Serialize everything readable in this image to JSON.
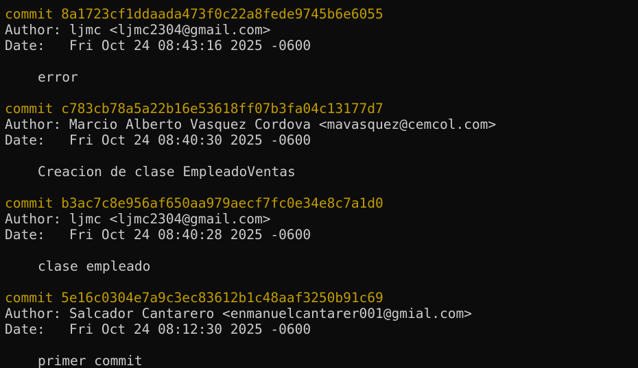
{
  "commits": [
    {
      "hash_line": "commit 8a1723cf1ddaada473f0c22a8fede9745b6e6055",
      "author_line": "Author: ljmc <ljmc2304@gmail.com>",
      "date_line": "Date:   Fri Oct 24 08:43:16 2025 -0600",
      "message": "error"
    },
    {
      "hash_line": "commit c783cb78a5a22b16e53618ff07b3fa04c13177d7",
      "author_line": "Author: Marcio Alberto Vasquez Cordova <mavasquez@cemcol.com>",
      "date_line": "Date:   Fri Oct 24 08:40:30 2025 -0600",
      "message": "Creacion de clase EmpleadoVentas"
    },
    {
      "hash_line": "commit b3ac7c8e956af650aa979aecf7fc0e34e8c7a1d0",
      "author_line": "Author: ljmc <ljmc2304@gmail.com>",
      "date_line": "Date:   Fri Oct 24 08:40:28 2025 -0600",
      "message": "clase empleado"
    },
    {
      "hash_line": "commit 5e16c0304e7a9c3ec83612b1c48aaf3250b91c69",
      "author_line": "Author: Salcador Cantarero <enmanuelcantarer001@gmial.com>",
      "date_line": "Date:   Fri Oct 24 08:12:30 2025 -0600",
      "message": "primer commit"
    }
  ],
  "colors": {
    "background": "#0c0c0c",
    "text": "#cccccc",
    "commit_hash": "#c19c00"
  }
}
